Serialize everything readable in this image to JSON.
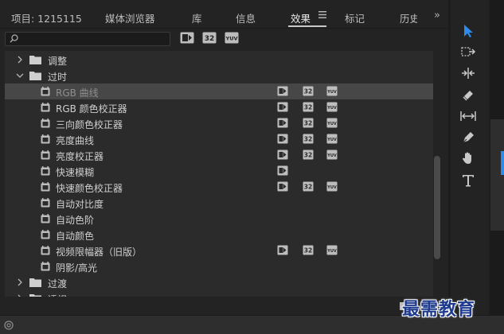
{
  "tabs": [
    {
      "label": "项目: 1215115"
    },
    {
      "label": "媒体浏览器"
    },
    {
      "label": "库"
    },
    {
      "label": "信息"
    },
    {
      "label": "效果"
    },
    {
      "label": "标记"
    },
    {
      "label": "历史"
    }
  ],
  "active_tab": "效果",
  "search": {
    "value": "",
    "placeholder": ""
  },
  "filter_badges": [
    {
      "icon": "accelerated-effects-icon",
      "text": ""
    },
    {
      "icon": "32-bit-color-icon",
      "text": "32"
    },
    {
      "icon": "yuv-effects-icon",
      "text": "YUV"
    }
  ],
  "tree": [
    {
      "type": "folder",
      "label": "调整",
      "expanded": false,
      "level": 0
    },
    {
      "type": "folder",
      "label": "过时",
      "expanded": true,
      "level": 0
    },
    {
      "type": "effect",
      "label": "RGB 曲线",
      "level": 1,
      "selected": true,
      "accel": true,
      "b32": true,
      "yuv": true
    },
    {
      "type": "effect",
      "label": "RGB 颜色校正器",
      "level": 1,
      "accel": true,
      "b32": true,
      "yuv": true
    },
    {
      "type": "effect",
      "label": "三向颜色校正器",
      "level": 1,
      "accel": true,
      "b32": true,
      "yuv": true
    },
    {
      "type": "effect",
      "label": "亮度曲线",
      "level": 1,
      "accel": true,
      "b32": true,
      "yuv": true
    },
    {
      "type": "effect",
      "label": "亮度校正器",
      "level": 1,
      "accel": true,
      "b32": true,
      "yuv": true
    },
    {
      "type": "effect",
      "label": "快速模糊",
      "level": 1,
      "accel": true,
      "b32": false,
      "yuv": false
    },
    {
      "type": "effect",
      "label": "快速颜色校正器",
      "level": 1,
      "accel": true,
      "b32": true,
      "yuv": true
    },
    {
      "type": "effect",
      "label": "自动对比度",
      "level": 1,
      "accel": false,
      "b32": false,
      "yuv": false
    },
    {
      "type": "effect",
      "label": "自动色阶",
      "level": 1,
      "accel": false,
      "b32": false,
      "yuv": false
    },
    {
      "type": "effect",
      "label": "自动颜色",
      "level": 1,
      "accel": false,
      "b32": false,
      "yuv": false
    },
    {
      "type": "effect",
      "label": "视频限幅器（旧版）",
      "level": 1,
      "accel": true,
      "b32": true,
      "yuv": true
    },
    {
      "type": "effect",
      "label": "阴影/高光",
      "level": 1,
      "accel": false,
      "b32": false,
      "yuv": false
    },
    {
      "type": "folder",
      "label": "过渡",
      "expanded": false,
      "level": 0
    },
    {
      "type": "folder",
      "label": "透视",
      "expanded": false,
      "level": 0
    }
  ],
  "tools": [
    {
      "icon": "selection-tool-icon",
      "active": true
    },
    {
      "icon": "track-select-tool-icon",
      "active": false
    },
    {
      "icon": "ripple-edit-tool-icon",
      "active": false
    },
    {
      "icon": "razor-tool-icon",
      "active": false
    },
    {
      "icon": "slip-tool-icon",
      "active": false
    },
    {
      "icon": "pen-tool-icon",
      "active": false
    },
    {
      "icon": "hand-tool-icon",
      "active": false
    },
    {
      "icon": "type-tool-icon",
      "active": false
    }
  ],
  "watermark": "最需教育",
  "colors": {
    "accent": "#2d8ceb",
    "panel": "#232323",
    "list": "#2b2b2b",
    "selected_row": "#474747",
    "watermark": "#1e3a8f"
  }
}
